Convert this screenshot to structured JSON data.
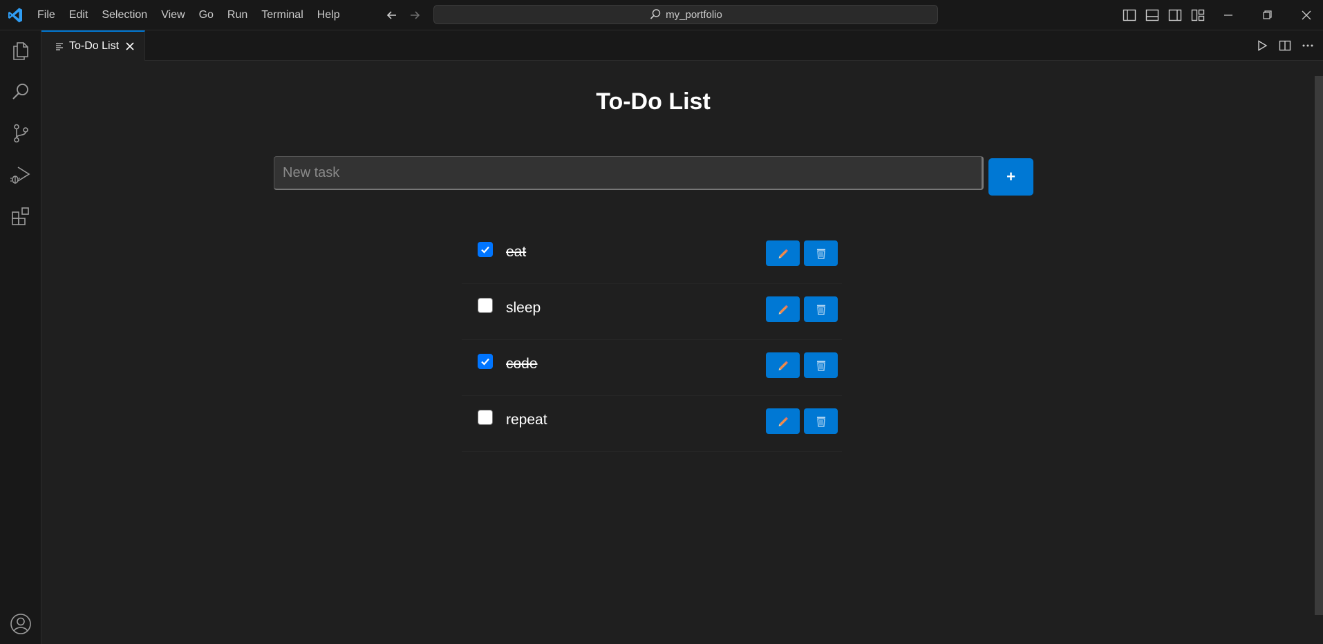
{
  "menu": [
    "File",
    "Edit",
    "Selection",
    "View",
    "Go",
    "Run",
    "Terminal",
    "Help"
  ],
  "search": {
    "label": "my_portfolio"
  },
  "tab": {
    "label": "To-Do List"
  },
  "app": {
    "title": "To-Do List",
    "input_placeholder": "New task",
    "add_label": "+",
    "tasks": [
      {
        "text": "eat",
        "done": true
      },
      {
        "text": "sleep",
        "done": false
      },
      {
        "text": "code",
        "done": true
      },
      {
        "text": "repeat",
        "done": false
      }
    ]
  },
  "colors": {
    "accent": "#0078d4",
    "checkbox_checked": "#0075ff",
    "editor_bg": "#1f1f1f",
    "chrome_bg": "#181818"
  },
  "icons": {
    "activity": [
      "explorer-icon",
      "search-icon",
      "source-control-icon",
      "run-debug-icon",
      "extensions-icon",
      "account-icon"
    ],
    "edit": "pencil-icon",
    "delete": "wastebasket-icon"
  }
}
